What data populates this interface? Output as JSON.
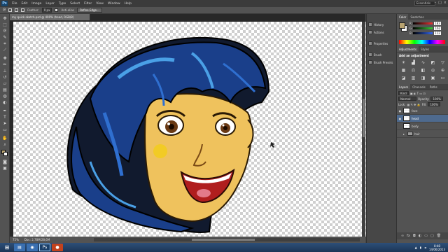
{
  "menubar": {
    "logo": "Ps",
    "items": [
      "File",
      "Edit",
      "Image",
      "Layer",
      "Type",
      "Select",
      "Filter",
      "View",
      "Window",
      "Help"
    ],
    "workspace": "Essentials"
  },
  "options": {
    "feather_label": "Feather:",
    "feather_value": "0 px",
    "antialias_label": "Anti-alias",
    "refine_edge": "Refine Edge..."
  },
  "document": {
    "tab_title": "my quick sketch.psd @ 400% (head, RGB/8)",
    "zoom": "75%",
    "doc_info": "Doc: 2,78M/28,6M"
  },
  "iconstrip": {
    "items": [
      "History",
      "Actions",
      "Properties",
      "Brush",
      "Brush Presets"
    ]
  },
  "color_panel": {
    "tabs": [
      "Color",
      "Swatches"
    ],
    "sliders": [
      {
        "label": "R",
        "value": "183",
        "track": "#e33"
      },
      {
        "label": "G",
        "value": "162",
        "track": "#3c3"
      },
      {
        "label": "B",
        "value": "112",
        "track": "#36e"
      }
    ]
  },
  "adjustments": {
    "tabs": [
      "Adjustments",
      "Styles"
    ],
    "title": "Add an adjustment"
  },
  "layers": {
    "tabs": [
      "Layers",
      "Channels",
      "Paths"
    ],
    "kind": "Kind",
    "blend_mode": "Normal",
    "opacity_label": "Opacity:",
    "opacity": "100%",
    "lock_label": "Lock:",
    "fill_label": "Fill:",
    "fill": "100%",
    "items": [
      {
        "name": "face",
        "visible": true,
        "selected": false,
        "type": "layer"
      },
      {
        "name": "head",
        "visible": true,
        "selected": true,
        "type": "layer"
      },
      {
        "name": "body",
        "visible": false,
        "selected": false,
        "type": "layer"
      },
      {
        "name": "hair",
        "visible": false,
        "selected": false,
        "type": "group"
      }
    ]
  },
  "taskbar": {
    "time": "8:48",
    "date": "14/06/2013"
  },
  "colors": {
    "hair": "#1a3f8a",
    "skin": "#efc25d",
    "selected_layer": "#4e6a8e"
  }
}
